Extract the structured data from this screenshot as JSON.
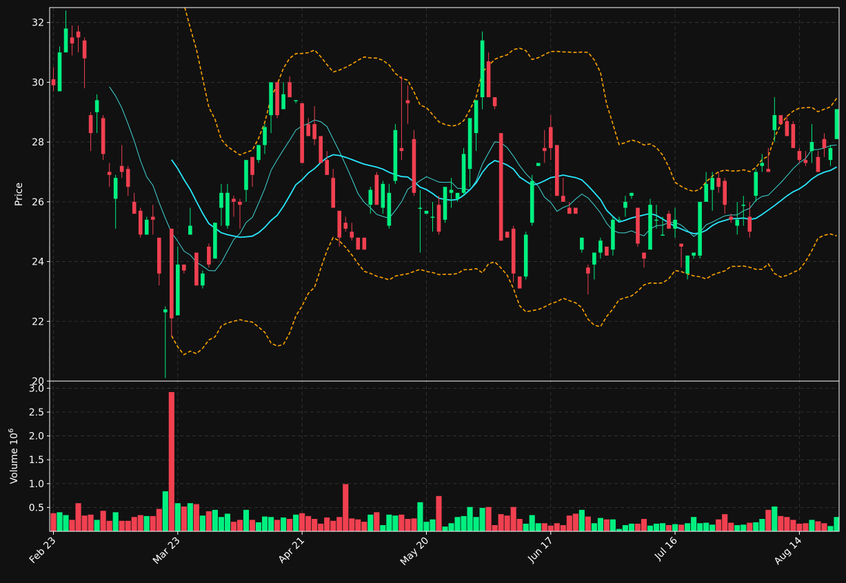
{
  "chart_data": {
    "type": "candlestick",
    "colors": {
      "background": "#111111",
      "up": "#00f080",
      "down": "#f04050",
      "ma_fast": "#40d8d8",
      "ma_slow": "#28e8ff",
      "bollinger": "#ffa500",
      "grid": "#3a3a3a",
      "text": "#ffffff"
    },
    "price_panel": {
      "ylabel": "Price",
      "ylim": [
        20,
        32.5
      ],
      "yticks": [
        "20",
        "22",
        "24",
        "26",
        "28",
        "30",
        "32"
      ]
    },
    "volume_panel": {
      "ylabel": "Volume",
      "yscale_label": "10",
      "yscale_exponent": "6",
      "ylim": [
        0,
        3.15
      ],
      "yticks": [
        "0.5",
        "1.0",
        "1.5",
        "2.0",
        "2.5",
        "3.0"
      ]
    },
    "x_ticks": [
      {
        "label": "Feb 23",
        "index": 0
      },
      {
        "label": "Mar 23",
        "index": 20
      },
      {
        "label": "Apr 21",
        "index": 40
      },
      {
        "label": "May 20",
        "index": 60
      },
      {
        "label": "Jun 17",
        "index": 80
      },
      {
        "label": "Jul 16",
        "index": 100
      },
      {
        "label": "Aug 14",
        "index": 120
      }
    ],
    "candles": [
      [
        30.1,
        30.5,
        29.7,
        29.9,
        0.38
      ],
      [
        29.7,
        31.2,
        29.7,
        31.0,
        0.4
      ],
      [
        31.0,
        32.4,
        31.0,
        31.8,
        0.34
      ],
      [
        31.5,
        31.9,
        30.9,
        31.3,
        0.24
      ],
      [
        31.7,
        31.9,
        31.0,
        31.5,
        0.59
      ],
      [
        31.4,
        31.5,
        29.8,
        30.8,
        0.33
      ],
      [
        28.9,
        29.0,
        27.7,
        28.3,
        0.35
      ],
      [
        29.0,
        29.6,
        28.3,
        29.4,
        0.24
      ],
      [
        28.8,
        28.9,
        27.4,
        27.6,
        0.43
      ],
      [
        27.0,
        27.3,
        26.5,
        26.9,
        0.22
      ],
      [
        26.1,
        26.9,
        25.1,
        26.8,
        0.4
      ],
      [
        27.2,
        27.9,
        26.8,
        27.0,
        0.22
      ],
      [
        27.1,
        27.2,
        26.2,
        26.5,
        0.22
      ],
      [
        26.0,
        26.3,
        25.6,
        25.6,
        0.3
      ],
      [
        25.7,
        25.8,
        24.8,
        24.9,
        0.34
      ],
      [
        24.9,
        25.5,
        24.9,
        25.4,
        0.32
      ],
      [
        25.5,
        25.9,
        24.9,
        25.4,
        0.32
      ],
      [
        24.8,
        24.8,
        23.2,
        23.6,
        0.47
      ],
      [
        22.3,
        22.5,
        20.1,
        22.4,
        0.84
      ],
      [
        25.1,
        25.1,
        21.5,
        22.1,
        2.92
      ],
      [
        22.2,
        24.5,
        22.2,
        23.9,
        0.59
      ],
      [
        23.9,
        23.9,
        23.6,
        23.7,
        0.52
      ],
      [
        24.9,
        25.8,
        24.9,
        25.2,
        0.59
      ],
      [
        24.3,
        24.3,
        23.2,
        23.2,
        0.57
      ],
      [
        23.2,
        23.7,
        23.1,
        23.6,
        0.33
      ],
      [
        24.5,
        24.6,
        23.8,
        23.9,
        0.42
      ],
      [
        24.1,
        25.3,
        24.1,
        25.3,
        0.45
      ],
      [
        25.8,
        26.6,
        25.2,
        26.3,
        0.3
      ],
      [
        25.2,
        26.6,
        25.1,
        26.3,
        0.37
      ],
      [
        26.1,
        26.2,
        25.5,
        26.0,
        0.2
      ],
      [
        26.0,
        26.1,
        25.1,
        25.9,
        0.24
      ],
      [
        26.4,
        26.7,
        26.0,
        27.4,
        0.45
      ],
      [
        27.5,
        27.5,
        26.5,
        26.9,
        0.24
      ],
      [
        27.4,
        27.9,
        27.3,
        27.9,
        0.19
      ],
      [
        27.9,
        28.6,
        27.6,
        28.5,
        0.31
      ],
      [
        28.9,
        30.0,
        28.3,
        30.0,
        0.3
      ],
      [
        30.0,
        30.0,
        28.8,
        28.9,
        0.24
      ],
      [
        29.1,
        30.0,
        29.1,
        29.6,
        0.29
      ],
      [
        30.0,
        30.2,
        29.5,
        29.5,
        0.26
      ],
      [
        29.4,
        29.4,
        29.3,
        29.4,
        0.35
      ],
      [
        29.3,
        29.3,
        27.3,
        27.3,
        0.38
      ],
      [
        28.6,
        28.8,
        28.2,
        28.2,
        0.32
      ],
      [
        28.6,
        29.2,
        27.9,
        28.1,
        0.26
      ],
      [
        28.2,
        28.2,
        27.3,
        27.3,
        0.16
      ],
      [
        27.4,
        27.7,
        26.9,
        26.9,
        0.29
      ],
      [
        26.8,
        27.1,
        25.8,
        25.8,
        0.22
      ],
      [
        25.7,
        25.7,
        24.5,
        24.8,
        0.3
      ],
      [
        25.3,
        25.5,
        25.0,
        25.1,
        0.99
      ],
      [
        25.0,
        25.3,
        24.7,
        24.8,
        0.27
      ],
      [
        24.8,
        24.8,
        24.4,
        24.4,
        0.25
      ],
      [
        24.8,
        24.8,
        24.4,
        24.4,
        0.2
      ],
      [
        25.9,
        26.5,
        25.6,
        26.4,
        0.35
      ],
      [
        26.9,
        27.0,
        25.9,
        25.9,
        0.4
      ],
      [
        25.8,
        26.7,
        25.6,
        26.6,
        0.13
      ],
      [
        25.2,
        26.6,
        25.1,
        26.3,
        0.35
      ],
      [
        26.7,
        28.6,
        26.6,
        28.4,
        0.33
      ],
      [
        27.8,
        30.2,
        27.4,
        27.7,
        0.35
      ],
      [
        29.4,
        29.9,
        28.6,
        29.3,
        0.26
      ],
      [
        28.1,
        28.4,
        26.2,
        26.3,
        0.27
      ],
      [
        25.8,
        26.4,
        24.3,
        25.8,
        0.61
      ],
      [
        25.6,
        25.6,
        25.6,
        25.7,
        0.2
      ],
      [
        25.5,
        26.0,
        25.0,
        25.5,
        0.25
      ],
      [
        25.9,
        26.2,
        24.9,
        25.0,
        0.74
      ],
      [
        25.4,
        26.2,
        25.3,
        26.5,
        0.1
      ],
      [
        26.3,
        26.8,
        25.8,
        26.4,
        0.17
      ],
      [
        26.1,
        26.2,
        26.0,
        26.3,
        0.3
      ],
      [
        26.3,
        27.8,
        26.2,
        27.6,
        0.32
      ],
      [
        27.1,
        28.3,
        26.5,
        28.8,
        0.51
      ],
      [
        28.3,
        29.0,
        27.7,
        29.4,
        0.3
      ],
      [
        29.5,
        31.7,
        29.1,
        31.4,
        0.49
      ],
      [
        30.7,
        31.0,
        29.5,
        29.5,
        0.51
      ],
      [
        29.5,
        29.5,
        29.1,
        29.2,
        0.13
      ],
      [
        28.3,
        28.3,
        24.7,
        24.7,
        0.36
      ],
      [
        25.0,
        25.0,
        24.8,
        24.8,
        0.33
      ],
      [
        25.1,
        25.2,
        23.3,
        23.6,
        0.51
      ],
      [
        23.5,
        23.5,
        23.1,
        23.1,
        0.26
      ],
      [
        23.5,
        25.0,
        23.4,
        24.9,
        0.16
      ],
      [
        25.3,
        26.9,
        25.2,
        26.7,
        0.34
      ],
      [
        27.2,
        27.3,
        27.3,
        27.3,
        0.17
      ],
      [
        27.8,
        28.4,
        27.3,
        27.7,
        0.17
      ],
      [
        28.5,
        28.9,
        27.4,
        27.8,
        0.12
      ],
      [
        27.9,
        27.9,
        26.2,
        26.2,
        0.17
      ],
      [
        26.2,
        26.8,
        26.1,
        26.0,
        0.13
      ],
      [
        25.8,
        26.0,
        25.6,
        25.6,
        0.33
      ],
      [
        25.8,
        25.8,
        25.6,
        25.6,
        0.37
      ],
      [
        24.4,
        24.8,
        24.3,
        24.8,
        0.45
      ],
      [
        23.8,
        23.9,
        22.9,
        23.6,
        0.31
      ],
      [
        23.9,
        24.3,
        23.4,
        24.3,
        0.17
      ],
      [
        24.3,
        24.8,
        24.1,
        24.7,
        0.28
      ],
      [
        24.5,
        24.5,
        24.2,
        24.2,
        0.25
      ],
      [
        24.4,
        25.5,
        24.2,
        25.4,
        0.25
      ],
      [
        25.4,
        25.5,
        25.4,
        25.4,
        0.05
      ],
      [
        25.8,
        26.2,
        25.5,
        26.0,
        0.13
      ],
      [
        26.2,
        26.3,
        26.1,
        26.3,
        0.16
      ],
      [
        25.8,
        25.8,
        24.5,
        24.6,
        0.16
      ],
      [
        24.3,
        24.3,
        23.8,
        24.1,
        0.26
      ],
      [
        24.4,
        26.1,
        24.4,
        25.9,
        0.12
      ],
      [
        25.4,
        25.9,
        25.1,
        25.4,
        0.16
      ],
      [
        24.9,
        25.5,
        24.9,
        24.9,
        0.17
      ],
      [
        25.6,
        25.7,
        25.1,
        25.1,
        0.13
      ],
      [
        25.1,
        25.8,
        24.8,
        25.4,
        0.15
      ],
      [
        24.6,
        24.6,
        23.8,
        24.5,
        0.14
      ],
      [
        23.6,
        24.2,
        23.4,
        24.2,
        0.17
      ],
      [
        24.2,
        24.3,
        24.1,
        24.3,
        0.3
      ],
      [
        24.2,
        25.2,
        24.1,
        26.0,
        0.17
      ],
      [
        26.0,
        27.0,
        26.0,
        26.6,
        0.18
      ],
      [
        26.4,
        27.0,
        25.7,
        26.8,
        0.14
      ],
      [
        26.8,
        27.0,
        26.3,
        26.5,
        0.25
      ],
      [
        26.7,
        26.8,
        25.6,
        25.9,
        0.36
      ],
      [
        25.5,
        25.6,
        25.3,
        25.4,
        0.18
      ],
      [
        25.2,
        26.0,
        24.9,
        25.4,
        0.13
      ],
      [
        25.9,
        26.2,
        25.2,
        25.9,
        0.14
      ],
      [
        25.5,
        26.0,
        24.8,
        25.0,
        0.18
      ],
      [
        26.2,
        27.1,
        26.0,
        27.0,
        0.19
      ],
      [
        27.2,
        27.6,
        27.0,
        27.3,
        0.26
      ],
      [
        27.1,
        27.8,
        27.0,
        27.0,
        0.45
      ],
      [
        28.4,
        29.5,
        28.0,
        28.9,
        0.52
      ],
      [
        28.9,
        28.9,
        28.8,
        28.6,
        0.32
      ],
      [
        28.7,
        28.9,
        28.3,
        28.2,
        0.3
      ],
      [
        28.6,
        28.7,
        27.9,
        27.8,
        0.24
      ],
      [
        27.7,
        27.8,
        27.3,
        27.4,
        0.16
      ],
      [
        27.4,
        27.7,
        27.2,
        27.3,
        0.17
      ],
      [
        27.7,
        28.6,
        27.3,
        28.0,
        0.24
      ],
      [
        27.5,
        27.7,
        27.4,
        27.0,
        0.21
      ],
      [
        28.1,
        28.3,
        27.5,
        27.8,
        0.17
      ],
      [
        27.4,
        27.9,
        27.2,
        27.8,
        0.11
      ],
      [
        28.1,
        29.1,
        28.1,
        29.1,
        0.3
      ]
    ]
  }
}
